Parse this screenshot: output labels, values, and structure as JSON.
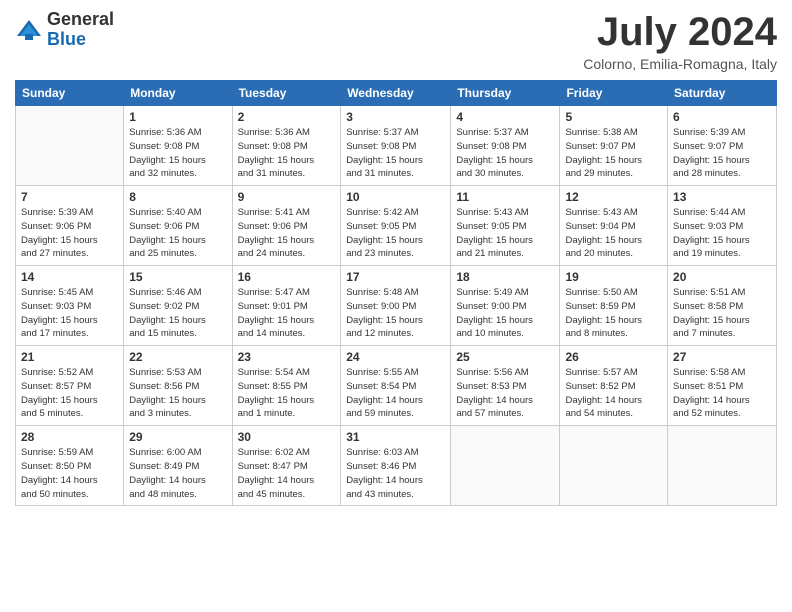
{
  "logo": {
    "general": "General",
    "blue": "Blue"
  },
  "title": "July 2024",
  "location": "Colorno, Emilia-Romagna, Italy",
  "days_header": [
    "Sunday",
    "Monday",
    "Tuesday",
    "Wednesday",
    "Thursday",
    "Friday",
    "Saturday"
  ],
  "weeks": [
    [
      {
        "num": "",
        "info": ""
      },
      {
        "num": "1",
        "info": "Sunrise: 5:36 AM\nSunset: 9:08 PM\nDaylight: 15 hours\nand 32 minutes."
      },
      {
        "num": "2",
        "info": "Sunrise: 5:36 AM\nSunset: 9:08 PM\nDaylight: 15 hours\nand 31 minutes."
      },
      {
        "num": "3",
        "info": "Sunrise: 5:37 AM\nSunset: 9:08 PM\nDaylight: 15 hours\nand 31 minutes."
      },
      {
        "num": "4",
        "info": "Sunrise: 5:37 AM\nSunset: 9:08 PM\nDaylight: 15 hours\nand 30 minutes."
      },
      {
        "num": "5",
        "info": "Sunrise: 5:38 AM\nSunset: 9:07 PM\nDaylight: 15 hours\nand 29 minutes."
      },
      {
        "num": "6",
        "info": "Sunrise: 5:39 AM\nSunset: 9:07 PM\nDaylight: 15 hours\nand 28 minutes."
      }
    ],
    [
      {
        "num": "7",
        "info": "Sunrise: 5:39 AM\nSunset: 9:06 PM\nDaylight: 15 hours\nand 27 minutes."
      },
      {
        "num": "8",
        "info": "Sunrise: 5:40 AM\nSunset: 9:06 PM\nDaylight: 15 hours\nand 25 minutes."
      },
      {
        "num": "9",
        "info": "Sunrise: 5:41 AM\nSunset: 9:06 PM\nDaylight: 15 hours\nand 24 minutes."
      },
      {
        "num": "10",
        "info": "Sunrise: 5:42 AM\nSunset: 9:05 PM\nDaylight: 15 hours\nand 23 minutes."
      },
      {
        "num": "11",
        "info": "Sunrise: 5:43 AM\nSunset: 9:05 PM\nDaylight: 15 hours\nand 21 minutes."
      },
      {
        "num": "12",
        "info": "Sunrise: 5:43 AM\nSunset: 9:04 PM\nDaylight: 15 hours\nand 20 minutes."
      },
      {
        "num": "13",
        "info": "Sunrise: 5:44 AM\nSunset: 9:03 PM\nDaylight: 15 hours\nand 19 minutes."
      }
    ],
    [
      {
        "num": "14",
        "info": "Sunrise: 5:45 AM\nSunset: 9:03 PM\nDaylight: 15 hours\nand 17 minutes."
      },
      {
        "num": "15",
        "info": "Sunrise: 5:46 AM\nSunset: 9:02 PM\nDaylight: 15 hours\nand 15 minutes."
      },
      {
        "num": "16",
        "info": "Sunrise: 5:47 AM\nSunset: 9:01 PM\nDaylight: 15 hours\nand 14 minutes."
      },
      {
        "num": "17",
        "info": "Sunrise: 5:48 AM\nSunset: 9:00 PM\nDaylight: 15 hours\nand 12 minutes."
      },
      {
        "num": "18",
        "info": "Sunrise: 5:49 AM\nSunset: 9:00 PM\nDaylight: 15 hours\nand 10 minutes."
      },
      {
        "num": "19",
        "info": "Sunrise: 5:50 AM\nSunset: 8:59 PM\nDaylight: 15 hours\nand 8 minutes."
      },
      {
        "num": "20",
        "info": "Sunrise: 5:51 AM\nSunset: 8:58 PM\nDaylight: 15 hours\nand 7 minutes."
      }
    ],
    [
      {
        "num": "21",
        "info": "Sunrise: 5:52 AM\nSunset: 8:57 PM\nDaylight: 15 hours\nand 5 minutes."
      },
      {
        "num": "22",
        "info": "Sunrise: 5:53 AM\nSunset: 8:56 PM\nDaylight: 15 hours\nand 3 minutes."
      },
      {
        "num": "23",
        "info": "Sunrise: 5:54 AM\nSunset: 8:55 PM\nDaylight: 15 hours\nand 1 minute."
      },
      {
        "num": "24",
        "info": "Sunrise: 5:55 AM\nSunset: 8:54 PM\nDaylight: 14 hours\nand 59 minutes."
      },
      {
        "num": "25",
        "info": "Sunrise: 5:56 AM\nSunset: 8:53 PM\nDaylight: 14 hours\nand 57 minutes."
      },
      {
        "num": "26",
        "info": "Sunrise: 5:57 AM\nSunset: 8:52 PM\nDaylight: 14 hours\nand 54 minutes."
      },
      {
        "num": "27",
        "info": "Sunrise: 5:58 AM\nSunset: 8:51 PM\nDaylight: 14 hours\nand 52 minutes."
      }
    ],
    [
      {
        "num": "28",
        "info": "Sunrise: 5:59 AM\nSunset: 8:50 PM\nDaylight: 14 hours\nand 50 minutes."
      },
      {
        "num": "29",
        "info": "Sunrise: 6:00 AM\nSunset: 8:49 PM\nDaylight: 14 hours\nand 48 minutes."
      },
      {
        "num": "30",
        "info": "Sunrise: 6:02 AM\nSunset: 8:47 PM\nDaylight: 14 hours\nand 45 minutes."
      },
      {
        "num": "31",
        "info": "Sunrise: 6:03 AM\nSunset: 8:46 PM\nDaylight: 14 hours\nand 43 minutes."
      },
      {
        "num": "",
        "info": ""
      },
      {
        "num": "",
        "info": ""
      },
      {
        "num": "",
        "info": ""
      }
    ]
  ]
}
